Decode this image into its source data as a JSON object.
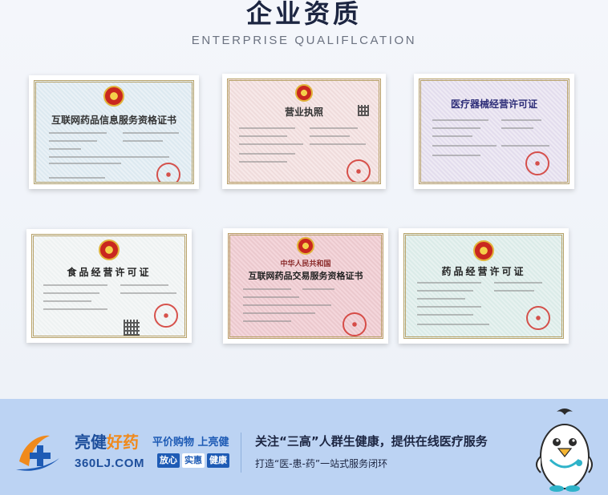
{
  "header": {
    "title": "企业资质",
    "subtitle": "ENTERPRISE QUALIFLCATION"
  },
  "certificates": [
    {
      "title": "互联网药品信息服务资格证书"
    },
    {
      "title": "营业执照"
    },
    {
      "title": "医疗器械经营许可证"
    },
    {
      "title": "食品经营许可证"
    },
    {
      "title_top": "中华人民共和国",
      "title": "互联网药品交易服务资格证书"
    },
    {
      "title": "药品经营许可证"
    }
  ],
  "banner": {
    "brand_main": "亮健",
    "brand_accent": "好药",
    "url": "360LJ.COM",
    "slogan_part1": "平价购物",
    "slogan_part2": "上亮健",
    "badges": [
      "放心",
      "实惠",
      "健康"
    ],
    "headline": "关注“三高”人群生健康，提供在线医疗服务",
    "subline": "打造“医-患-药”一站式服务闭环"
  },
  "colors": {
    "brand_blue": "#1e5bb5",
    "brand_orange": "#f08a1c",
    "banner_bg": "#bcd3f3"
  }
}
